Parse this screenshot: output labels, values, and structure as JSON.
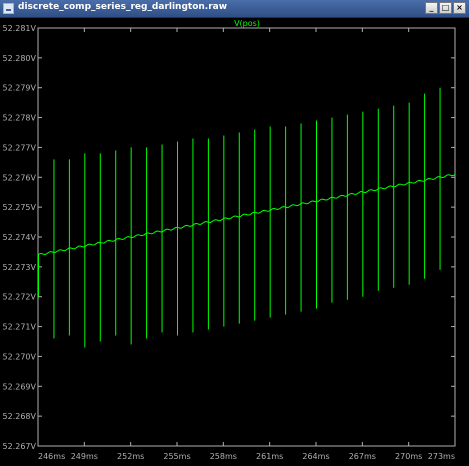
{
  "window": {
    "title": "discrete_comp_series_reg_darlington.raw",
    "buttons": {
      "minimize": "_",
      "maximize": "□",
      "close": "×"
    }
  },
  "colors": {
    "trace": "#00ff00",
    "axis": "#b0b0b0",
    "background": "#000000",
    "label": "#b0b0b0"
  },
  "chart_data": {
    "type": "line",
    "title": "V(pos)",
    "xlabel": "",
    "ylabel": "",
    "grid": false,
    "xlim": [
      246,
      273
    ],
    "ylim": [
      52.267,
      52.281
    ],
    "x_ticks": [
      246,
      249,
      252,
      255,
      258,
      261,
      264,
      267,
      270,
      273
    ],
    "x_tick_labels": [
      "246ms",
      "249ms",
      "252ms",
      "255ms",
      "258ms",
      "261ms",
      "264ms",
      "267ms",
      "270ms",
      "273ms"
    ],
    "y_ticks": [
      52.267,
      52.268,
      52.269,
      52.27,
      52.271,
      52.272,
      52.273,
      52.274,
      52.275,
      52.276,
      52.277,
      52.278,
      52.279,
      52.28,
      52.281
    ],
    "y_tick_labels": [
      "52.267V",
      "52.268V",
      "52.269V",
      "52.270V",
      "52.271V",
      "52.272V",
      "52.273V",
      "52.274V",
      "52.275V",
      "52.276V",
      "52.277V",
      "52.278V",
      "52.279V",
      "52.280V",
      "52.281V"
    ],
    "series": [
      {
        "x_unit": "ms",
        "y_unit": "V",
        "baseline": {
          "x": [
            246,
            273
          ],
          "y": [
            52.2734,
            52.2761
          ]
        },
        "spikes": [
          {
            "x": 246.0,
            "low": 52.272,
            "high": 52.2734
          },
          {
            "x": 247.0,
            "low": 52.2706,
            "high": 52.2766
          },
          {
            "x": 248.0,
            "low": 52.2707,
            "high": 52.2766
          },
          {
            "x": 249.0,
            "low": 52.2703,
            "high": 52.2768
          },
          {
            "x": 250.0,
            "low": 52.2705,
            "high": 52.2768
          },
          {
            "x": 251.0,
            "low": 52.2707,
            "high": 52.2769
          },
          {
            "x": 252.0,
            "low": 52.2704,
            "high": 52.277
          },
          {
            "x": 253.0,
            "low": 52.2706,
            "high": 52.277
          },
          {
            "x": 254.0,
            "low": 52.2708,
            "high": 52.2771
          },
          {
            "x": 255.0,
            "low": 52.2707,
            "high": 52.2772
          },
          {
            "x": 256.0,
            "low": 52.2708,
            "high": 52.2773
          },
          {
            "x": 257.0,
            "low": 52.2709,
            "high": 52.2773
          },
          {
            "x": 258.0,
            "low": 52.271,
            "high": 52.2774
          },
          {
            "x": 259.0,
            "low": 52.2711,
            "high": 52.2775
          },
          {
            "x": 260.0,
            "low": 52.2712,
            "high": 52.2776
          },
          {
            "x": 261.0,
            "low": 52.2713,
            "high": 52.2777
          },
          {
            "x": 262.0,
            "low": 52.2714,
            "high": 52.2777
          },
          {
            "x": 263.0,
            "low": 52.2715,
            "high": 52.2778
          },
          {
            "x": 264.0,
            "low": 52.2716,
            "high": 52.2779
          },
          {
            "x": 265.0,
            "low": 52.2718,
            "high": 52.278
          },
          {
            "x": 266.0,
            "low": 52.2719,
            "high": 52.2781
          },
          {
            "x": 267.0,
            "low": 52.272,
            "high": 52.2782
          },
          {
            "x": 268.0,
            "low": 52.2722,
            "high": 52.2783
          },
          {
            "x": 269.0,
            "low": 52.2723,
            "high": 52.2784
          },
          {
            "x": 270.0,
            "low": 52.2724,
            "high": 52.2785
          },
          {
            "x": 271.0,
            "low": 52.2726,
            "high": 52.2788
          },
          {
            "x": 272.0,
            "low": 52.2729,
            "high": 52.279
          }
        ]
      }
    ]
  }
}
